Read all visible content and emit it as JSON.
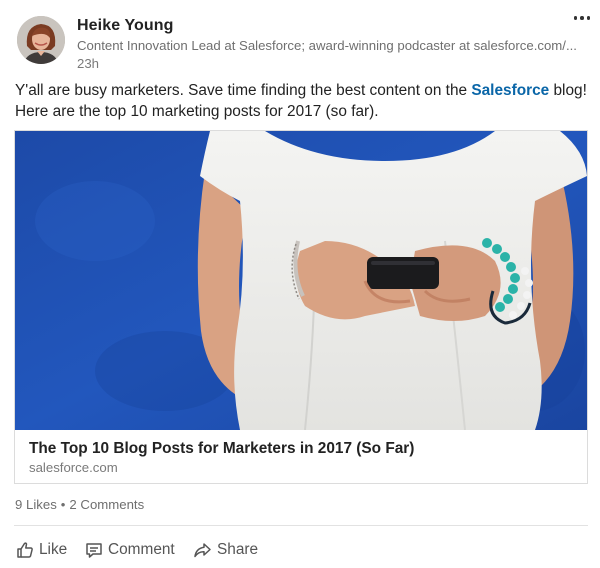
{
  "author": {
    "name": "Heike Young",
    "headline": "Content Innovation Lead at Salesforce; award-winning podcaster at salesforce.com/...",
    "time": "23h"
  },
  "post": {
    "text_before": "Y'all are busy marketers. Save time finding the best content on the ",
    "mention": "Salesforce",
    "text_after": " blog! Here are the top 10 marketing posts for 2017 (so far)."
  },
  "article": {
    "title": "The Top 10 Blog Posts for Marketers in 2017 (So Far)",
    "domain": "salesforce.com"
  },
  "social": {
    "likes": "9 Likes",
    "separator": "•",
    "comments": "2 Comments"
  },
  "actions": {
    "like_label": "Like",
    "comment_label": "Comment",
    "share_label": "Share"
  },
  "colors": {
    "mention": "#0a66a8",
    "background_wall": "#1f4fb0",
    "muted_text": "#6f6f6f"
  },
  "icons": {
    "menu": "more-dots-icon",
    "like": "thumbs-up-icon",
    "comment": "comment-icon",
    "share": "share-arrow-icon"
  }
}
